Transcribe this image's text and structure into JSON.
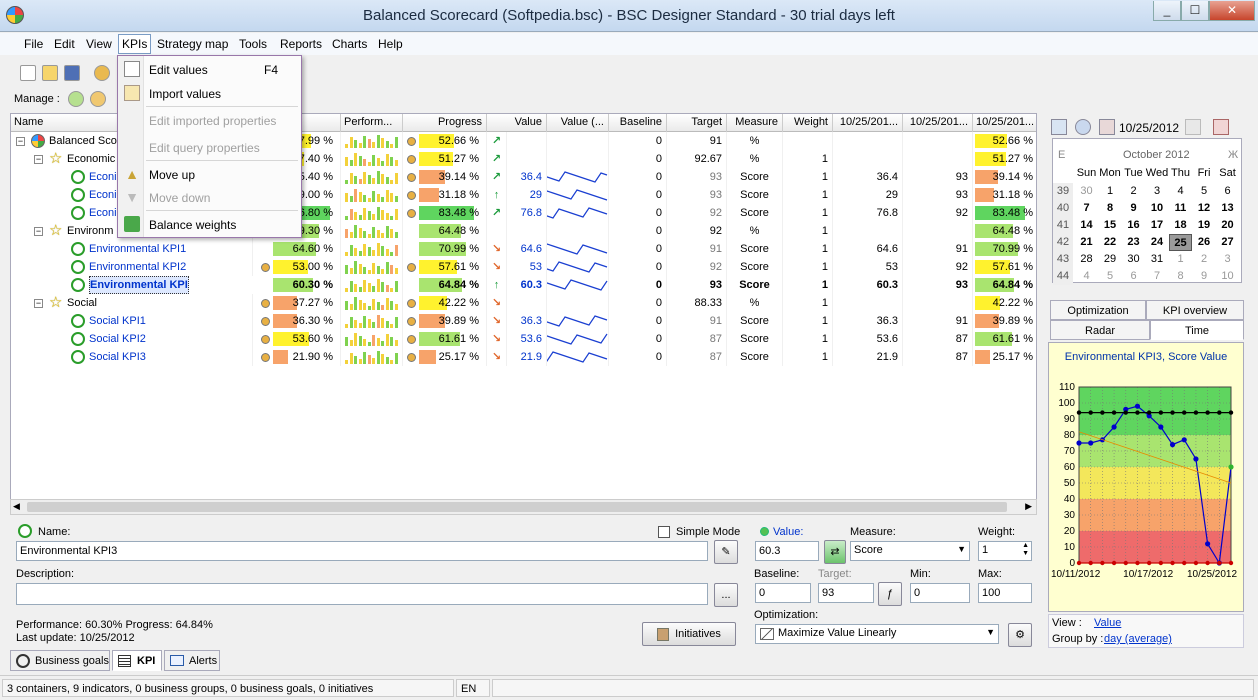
{
  "window": {
    "title": "Balanced Scorecard (Softpedia.bsc) - BSC Designer Standard - 30 trial days left",
    "min": "_",
    "max": "☐",
    "close": "✕"
  },
  "menu": [
    "File",
    "Edit",
    "View",
    "KPIs",
    "Strategy map",
    "Tools",
    "Reports",
    "Charts",
    "Help"
  ],
  "manage_label": "Manage :",
  "kpi_menu": {
    "items": [
      {
        "label": "Edit values",
        "shortcut": "F4",
        "disabled": false,
        "icon": "edit-values-icon"
      },
      {
        "label": "Import values",
        "shortcut": "",
        "disabled": false,
        "icon": "import-values-icon"
      },
      {
        "label": "Edit imported properties",
        "shortcut": "",
        "disabled": true,
        "icon": ""
      },
      {
        "label": "Edit query properties",
        "shortcut": "",
        "disabled": true,
        "icon": ""
      },
      {
        "label": "Move up",
        "shortcut": "",
        "disabled": false,
        "icon": "arrow-up-icon"
      },
      {
        "label": "Move down",
        "shortcut": "",
        "disabled": true,
        "icon": "arrow-down-icon"
      },
      {
        "label": "Balance weights",
        "shortcut": "",
        "disabled": false,
        "icon": "balance-weights-icon"
      }
    ]
  },
  "grid": {
    "columns": [
      "Name",
      "mance",
      "Perform...",
      "Progress",
      "Value",
      "Value (...",
      "Baseline",
      "Target",
      "Measure",
      "Weight",
      "10/25/201...",
      "10/25/201...",
      "10/25/201..."
    ],
    "rows": [
      {
        "level": 0,
        "type": "root",
        "name": "Balanced Scorecard",
        "name_visible": "Balanced Sco",
        "perf": "7.99 %",
        "perf_fill": 0.58,
        "perf_color": "#fff22e",
        "progress": "52.66 %",
        "progress_fill": 0.53,
        "progress_color": "#fff22e",
        "dot": "#e8b043",
        "arrow": "↗",
        "value": "",
        "spark": false,
        "baseline": "0",
        "target": "91",
        "measure": "%",
        "weight": "",
        "c1": "",
        "c2": "",
        "c3": "52.66 %",
        "c3_fill": 0.53,
        "c3_color": "#fff22e"
      },
      {
        "level": 1,
        "type": "container",
        "name": "Economic",
        "perf": "7.40 %",
        "perf_fill": 0.47,
        "perf_color": "#fff22e",
        "progress": "51.27 %",
        "progress_fill": 0.51,
        "progress_color": "#fff22e",
        "dot": "#e8b043",
        "arrow": "↗",
        "value": "",
        "spark": false,
        "baseline": "0",
        "target": "92.67",
        "measure": "%",
        "weight": "1",
        "c1": "",
        "c2": "",
        "c3": "51.27 %",
        "c3_fill": 0.51,
        "c3_color": "#fff22e"
      },
      {
        "level": 2,
        "type": "kpi",
        "name": "Economic KPI1",
        "name_visible": "Econim",
        "perf": "5.40 %",
        "perf_fill": 0.35,
        "perf_color": "#f7a36a",
        "progress": "39.14 %",
        "progress_fill": 0.39,
        "progress_color": "#f7a36a",
        "dot": "#e8b043",
        "arrow": "↗",
        "value": "36.4",
        "spark": true,
        "baseline": "0",
        "target": "93",
        "measure": "Score",
        "weight": "1",
        "c1": "36.4",
        "c2": "93",
        "c3": "39.14 %",
        "c3_fill": 0.39,
        "c3_color": "#f7a36a"
      },
      {
        "level": 2,
        "type": "kpi",
        "name": "Economic KPI2",
        "name_visible": "Econim",
        "perf": "9.00 %",
        "perf_fill": 0.3,
        "perf_color": "#f7a36a",
        "progress": "31.18 %",
        "progress_fill": 0.31,
        "progress_color": "#f7a36a",
        "dot": "#e8b043",
        "arrow": "↑",
        "value": "29",
        "spark": true,
        "baseline": "0",
        "target": "93",
        "measure": "Score",
        "weight": "1",
        "c1": "29",
        "c2": "93",
        "c3": "31.18 %",
        "c3_fill": 0.31,
        "c3_color": "#f7a36a"
      },
      {
        "level": 2,
        "type": "kpi",
        "name": "Economic KPI3",
        "name_visible": "Econim",
        "perf": "6.80 %",
        "perf_fill": 0.87,
        "perf_color": "#5fd55f",
        "progress": "83.48 %",
        "progress_fill": 0.83,
        "progress_color": "#5fd55f",
        "dot": "#e8b043",
        "arrow": "↗",
        "value": "76.8",
        "spark": true,
        "baseline": "0",
        "target": "92",
        "measure": "Score",
        "weight": "1",
        "c1": "76.8",
        "c2": "92",
        "c3": "83.48 %",
        "c3_fill": 0.83,
        "c3_color": "#5fd55f"
      },
      {
        "level": 1,
        "type": "container",
        "name": "Environmental",
        "name_visible": "Environm",
        "perf": "9.30 %",
        "perf_fill": 0.7,
        "perf_color": "#a9e46f",
        "progress": "64.48 %",
        "progress_fill": 0.64,
        "progress_color": "#a9e46f",
        "dot": "",
        "arrow": "",
        "value": "",
        "spark": false,
        "baseline": "0",
        "target": "92",
        "measure": "%",
        "weight": "1",
        "c1": "",
        "c2": "",
        "c3": "64.48 %",
        "c3_fill": 0.64,
        "c3_color": "#a9e46f"
      },
      {
        "level": 2,
        "type": "kpi",
        "name": "Environmental KPI1",
        "perf": "64.60 %",
        "perf_fill": 0.65,
        "perf_color": "#a9e46f",
        "progress": "70.99 %",
        "progress_fill": 0.71,
        "progress_color": "#a9e46f",
        "dot": "",
        "arrow": "↘",
        "value": "64.6",
        "spark": true,
        "baseline": "0",
        "target": "91",
        "measure": "Score",
        "weight": "1",
        "c1": "64.6",
        "c2": "91",
        "c3": "70.99 %",
        "c3_fill": 0.71,
        "c3_color": "#a9e46f"
      },
      {
        "level": 2,
        "type": "kpi",
        "name": "Environmental KPI2",
        "perf": "53.00 %",
        "perf_fill": 0.53,
        "perf_color": "#fff22e",
        "progress": "57.61 %",
        "progress_fill": 0.58,
        "progress_color": "#fff22e",
        "dot": "#e8b043",
        "arrow": "↘",
        "value": "53",
        "spark": true,
        "baseline": "0",
        "target": "92",
        "measure": "Score",
        "weight": "1",
        "c1": "53",
        "c2": "92",
        "c3": "57.61 %",
        "c3_fill": 0.58,
        "c3_color": "#fff22e"
      },
      {
        "level": 2,
        "type": "kpi",
        "name": "Environmental KPI3",
        "selected": true,
        "bold": true,
        "perf": "60.30 %",
        "perf_fill": 0.6,
        "perf_color": "#a9e46f",
        "progress": "64.84 %",
        "progress_fill": 0.65,
        "progress_color": "#a9e46f",
        "dot": "",
        "arrow": "↑",
        "value": "60.3",
        "spark": true,
        "baseline": "0",
        "target": "93",
        "measure": "Score",
        "weight": "1",
        "c1": "60.3",
        "c2": "93",
        "c3": "64.84 %",
        "c3_fill": 0.65,
        "c3_color": "#a9e46f"
      },
      {
        "level": 1,
        "type": "container",
        "name": "Social",
        "perf": "37.27 %",
        "perf_fill": 0.37,
        "perf_color": "#f7a36a",
        "progress": "42.22 %",
        "progress_fill": 0.42,
        "progress_color": "#fff22e",
        "dot": "#e8b043",
        "arrow": "↘",
        "value": "",
        "spark": false,
        "baseline": "0",
        "target": "88.33",
        "measure": "%",
        "weight": "1",
        "c1": "",
        "c2": "",
        "c3": "42.22 %",
        "c3_fill": 0.42,
        "c3_color": "#fff22e"
      },
      {
        "level": 2,
        "type": "kpi",
        "name": "Social KPI1",
        "perf": "36.30 %",
        "perf_fill": 0.36,
        "perf_color": "#f7a36a",
        "progress": "39.89 %",
        "progress_fill": 0.4,
        "progress_color": "#f7a36a",
        "dot": "#e8b043",
        "arrow": "↘",
        "value": "36.3",
        "spark": true,
        "baseline": "0",
        "target": "91",
        "measure": "Score",
        "weight": "1",
        "c1": "36.3",
        "c2": "91",
        "c3": "39.89 %",
        "c3_fill": 0.4,
        "c3_color": "#f7a36a"
      },
      {
        "level": 2,
        "type": "kpi",
        "name": "Social KPI2",
        "perf": "53.60 %",
        "perf_fill": 0.54,
        "perf_color": "#fff22e",
        "progress": "61.61 %",
        "progress_fill": 0.62,
        "progress_color": "#a9e46f",
        "dot": "#e8b043",
        "arrow": "↘",
        "value": "53.6",
        "spark": true,
        "baseline": "0",
        "target": "87",
        "measure": "Score",
        "weight": "1",
        "c1": "53.6",
        "c2": "87",
        "c3": "61.61 %",
        "c3_fill": 0.62,
        "c3_color": "#a9e46f"
      },
      {
        "level": 2,
        "type": "kpi",
        "name": "Social KPI3",
        "perf": "21.90 %",
        "perf_fill": 0.22,
        "perf_color": "#f7a36a",
        "progress": "25.17 %",
        "progress_fill": 0.25,
        "progress_color": "#f7a36a",
        "dot": "#e8b043",
        "arrow": "↘",
        "value": "21.9",
        "spark": true,
        "baseline": "0",
        "target": "87",
        "measure": "Score",
        "weight": "1",
        "c1": "21.9",
        "c2": "87",
        "c3": "25.17 %",
        "c3_fill": 0.25,
        "c3_color": "#f7a36a"
      }
    ]
  },
  "calendar": {
    "date": "10/25/2012",
    "month": "October 2012",
    "weekdays": [
      "Sun",
      "Mon",
      "Tue",
      "Wed",
      "Thu",
      "Fri",
      "Sat"
    ],
    "weeks": [
      {
        "wk": "39",
        "days": [
          "30",
          "1",
          "2",
          "3",
          "4",
          "5",
          "6"
        ]
      },
      {
        "wk": "40",
        "days": [
          "7",
          "8",
          "9",
          "10",
          "11",
          "12",
          "13"
        ]
      },
      {
        "wk": "41",
        "days": [
          "14",
          "15",
          "16",
          "17",
          "18",
          "19",
          "20"
        ]
      },
      {
        "wk": "42",
        "days": [
          "21",
          "22",
          "23",
          "24",
          "25",
          "26",
          "27"
        ]
      },
      {
        "wk": "43",
        "days": [
          "28",
          "29",
          "30",
          "31",
          "1",
          "2",
          "3"
        ]
      },
      {
        "wk": "44",
        "days": [
          "4",
          "5",
          "6",
          "7",
          "8",
          "9",
          "10"
        ]
      }
    ],
    "prev_label": "Е",
    "next_label": "Ж"
  },
  "right_tabs": [
    "Optimization",
    "KPI overview",
    "Radar",
    "Time"
  ],
  "chart_data": {
    "type": "line",
    "title": "Environmental KPI3, Score Value",
    "x_labels": [
      "10/11/2012",
      "10/17/2012",
      "10/25/2012"
    ],
    "ylim": [
      0,
      110
    ],
    "yticks": [
      0,
      10,
      20,
      30,
      40,
      50,
      60,
      70,
      80,
      90,
      100,
      110
    ],
    "bands": [
      {
        "from": 0,
        "to": 20,
        "color": "#ee6b6b"
      },
      {
        "from": 20,
        "to": 40,
        "color": "#f7a36a"
      },
      {
        "from": 40,
        "to": 60,
        "color": "#f3e75b"
      },
      {
        "from": 60,
        "to": 80,
        "color": "#a9e46f"
      },
      {
        "from": 80,
        "to": 110,
        "color": "#5fd55f"
      }
    ],
    "series": [
      {
        "color": "#0000cc",
        "values": [
          75,
          75,
          77,
          85,
          96,
          98,
          92,
          85,
          74,
          77,
          65,
          12,
          0,
          60
        ]
      },
      {
        "color": "#000000",
        "values": [
          94,
          94,
          94,
          94,
          94,
          94,
          94,
          94,
          94,
          94,
          94,
          94,
          94,
          94
        ]
      },
      {
        "color": "#cc0000",
        "values": [
          0,
          0,
          0,
          0,
          0,
          0,
          0,
          0,
          0,
          0,
          0,
          0,
          0,
          0
        ]
      },
      {
        "color": "#e88a00",
        "values": [
          82,
          null,
          null,
          null,
          null,
          null,
          null,
          null,
          null,
          null,
          null,
          null,
          null,
          50
        ]
      }
    ],
    "grid": true
  },
  "chart_footer": {
    "view_label": "View :",
    "view_value": "Value",
    "group_label": "Group by :",
    "group_value": "day (average)"
  },
  "form": {
    "name_label": "Name:",
    "name_value": "Environmental KPI3",
    "simple_mode": "Simple Mode",
    "value_label": "Value:",
    "value_value": "60.3",
    "measure_label": "Measure:",
    "measure_value": "Score",
    "weight_label": "Weight:",
    "weight_value": "1",
    "description_label": "Description:",
    "description_value": "",
    "baseline_label": "Baseline:",
    "baseline_value": "0",
    "target_label": "Target:",
    "target_value": "93",
    "min_label": "Min:",
    "min_value": "0",
    "max_label": "Max:",
    "max_value": "100",
    "optimization_label": "Optimization:",
    "optimization_value": "Maximize Value Linearly",
    "performance_text": "Performance: 60.30%  Progress: 64.84%",
    "last_update_text": "Last update: 10/25/2012",
    "initiatives_button": "Initiatives",
    "ellipsis_button": "..."
  },
  "bottom_tabs": [
    "Business goals",
    "KPI",
    "Alerts"
  ],
  "status": {
    "summary": "3 containers, 9 indicators, 0 business groups, 0 business goals, 0 initiatives",
    "lang": "EN"
  }
}
